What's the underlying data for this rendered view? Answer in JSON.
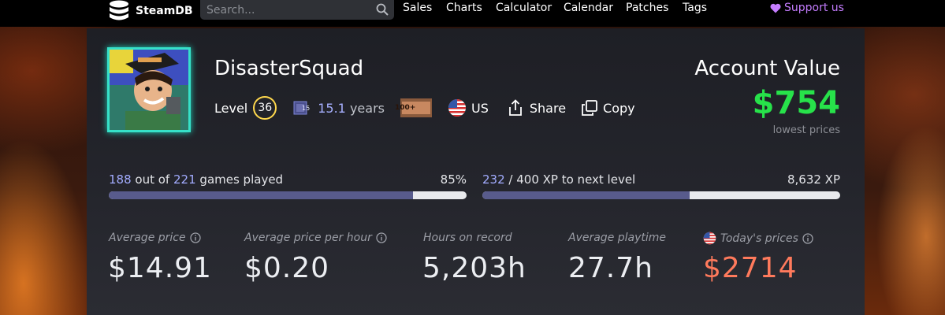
{
  "nav": {
    "brand": "SteamDB",
    "search_placeholder": "Search...",
    "links": [
      "Sales",
      "Charts",
      "Calculator",
      "Calendar",
      "Patches",
      "Tags"
    ],
    "support": "Support us"
  },
  "profile": {
    "username": "DisasterSquad",
    "level_label": "Level",
    "level": "36",
    "years_badge": "15",
    "years_num": "15.1",
    "years_unit": "years",
    "games_badge": "100+",
    "country": "US",
    "share": "Share",
    "copy": "Copy"
  },
  "account": {
    "title": "Account Value",
    "value": "$754",
    "note": "lowest prices"
  },
  "progress": {
    "games": {
      "played": "188",
      "mid": "out of",
      "total": "221",
      "suffix": "games played",
      "percent": "85%",
      "fill": 0.85
    },
    "xp": {
      "current": "232",
      "mid": "/ 400 XP to next level",
      "total": "8,632 XP",
      "fill": 0.58
    }
  },
  "stats": [
    {
      "label": "Average price",
      "value": "$14.91"
    },
    {
      "label": "Average price per hour",
      "value": "$0.20"
    },
    {
      "label": "Hours on record",
      "value": "5,203h"
    },
    {
      "label": "Average playtime",
      "value": "27.7h"
    },
    {
      "label": "Today's prices",
      "value": "$2714"
    }
  ],
  "colors": {
    "accent_green": "#27e24a",
    "today_price": "#ff7a5c",
    "support": "#c57dff",
    "progress_fill": "#585b8c"
  }
}
